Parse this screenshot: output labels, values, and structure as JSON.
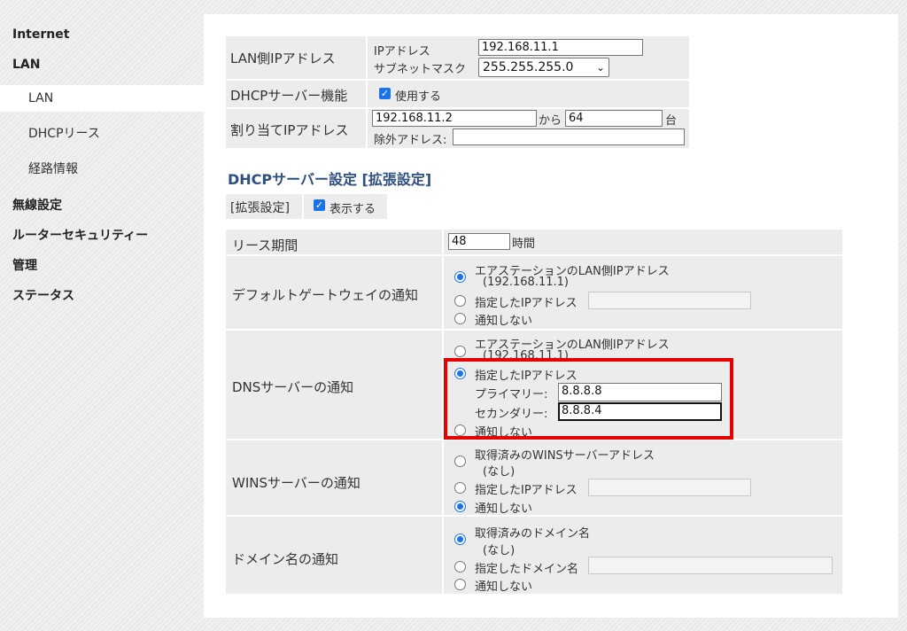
{
  "sidebar": {
    "internet": "Internet",
    "lan": "LAN",
    "lan_sub": "LAN",
    "dhcp_lease": "DHCPリース",
    "route_info": "経路情報",
    "wireless": "無線設定",
    "router_security": "ルーターセキュリティー",
    "admin": "管理",
    "status": "ステータス"
  },
  "lan_ip": {
    "label": "LAN側IPアドレス",
    "ip_label": "IPアドレス",
    "ip_value": "192.168.11.1",
    "subnet_label": "サブネットマスク",
    "subnet_value": "255.255.255.0"
  },
  "dhcp_function": {
    "label": "DHCPサーバー機能",
    "checkbox_label": "使用する"
  },
  "assign": {
    "label": "割り当てIPアドレス",
    "start_value": "192.168.11.2",
    "from_label": "から",
    "count_value": "64",
    "unit_label": "台",
    "exclude_label": "除外アドレス:",
    "exclude_value": ""
  },
  "section_title": "DHCPサーバー設定 [拡張設定]",
  "extended": {
    "label": "[拡張設定]",
    "checkbox_label": "表示する"
  },
  "lease": {
    "label": "リース期間",
    "value": "48",
    "unit": "時間"
  },
  "gateway": {
    "label": "デフォルトゲートウェイの通知",
    "opt1_line1": "エアステーションのLAN側IPアドレス",
    "opt1_line2": "(192.168.11.1)",
    "opt2": "指定したIPアドレス",
    "opt2_value": "",
    "opt3": "通知しない",
    "selected": 1
  },
  "dns": {
    "label": "DNSサーバーの通知",
    "opt1_line1": "エアステーションのLAN側IPアドレス",
    "opt1_line2": "(192.168.11.1)",
    "opt2": "指定したIPアドレス",
    "primary_label": "プライマリー:",
    "primary_value": "8.8.8.8",
    "secondary_label": "セカンダリー:",
    "secondary_value": "8.8.8.4",
    "opt3": "通知しない",
    "selected": 2,
    "highlight_color": "#e60000"
  },
  "wins": {
    "label": "WINSサーバーの通知",
    "opt1_line1": "取得済みのWINSサーバーアドレス",
    "opt1_line2": "(なし)",
    "opt2": "指定したIPアドレス",
    "opt2_value": "",
    "opt3": "通知しない",
    "selected": 3
  },
  "domain": {
    "label": "ドメイン名の通知",
    "opt1_line1": "取得済みのドメイン名",
    "opt1_line2": "(なし)",
    "opt2": "指定したドメイン名",
    "opt2_value": "",
    "opt3": "通知しない",
    "selected": 1
  },
  "colors": {
    "accent": "#1a73e8",
    "section_title": "#2f4f7f",
    "cell_bg": "#ececec"
  }
}
